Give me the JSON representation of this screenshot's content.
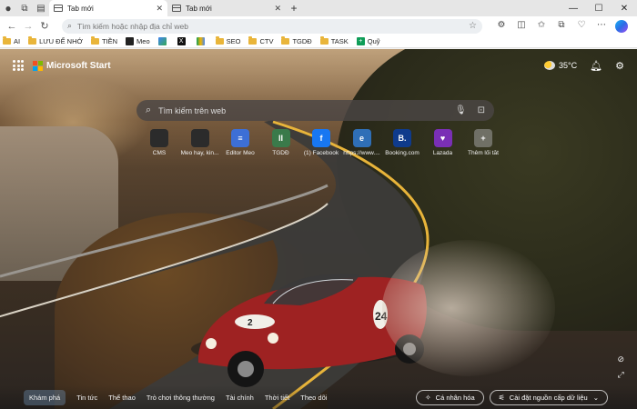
{
  "browser": {
    "tabs": [
      {
        "title": "Tab mới",
        "active": true
      },
      {
        "title": "Tab mới",
        "active": false
      }
    ],
    "address_placeholder": "Tìm kiếm hoặc nhập địa chỉ web",
    "bookmarks": [
      {
        "label": "AI",
        "kind": "folder"
      },
      {
        "label": "LƯU ĐỂ NHỚ",
        "kind": "folder"
      },
      {
        "label": "TIỀN",
        "kind": "folder"
      },
      {
        "label": "Meo",
        "kind": "page"
      },
      {
        "label": "",
        "kind": "drive"
      },
      {
        "label": "",
        "kind": "x"
      },
      {
        "label": "",
        "kind": "gdrive"
      },
      {
        "label": "SEO",
        "kind": "folder"
      },
      {
        "label": "CTV",
        "kind": "folder"
      },
      {
        "label": "TGDĐ",
        "kind": "folder"
      },
      {
        "label": "TASK",
        "kind": "folder"
      },
      {
        "label": "Quỹ",
        "kind": "sheet"
      }
    ]
  },
  "start": {
    "brand": "Microsoft Start",
    "weather": "35°C",
    "search_placeholder": "Tìm kiếm trên web",
    "quicklinks": [
      {
        "label": "CMS",
        "icon": "",
        "color": "#2b2b2b"
      },
      {
        "label": "Meo hay, kin...",
        "icon": "",
        "color": "#2b2b2b"
      },
      {
        "label": "Editor Meo",
        "icon": "≡",
        "color": "#3d6fd6"
      },
      {
        "label": "TGDĐ",
        "icon": "II",
        "color": "#3a7a4a"
      },
      {
        "label": "(1) Facebook",
        "icon": "f",
        "color": "#1877f2"
      },
      {
        "label": "https://www....",
        "icon": "e",
        "color": "#2f6fb7"
      },
      {
        "label": "Booking.com",
        "icon": "B.",
        "color": "#0f3b8c"
      },
      {
        "label": "Lazada",
        "icon": "♥",
        "color": "#7a2fb5"
      },
      {
        "label": "Thêm lối tắt",
        "icon": "+",
        "color": "rgba(160,160,160,0.55)"
      }
    ],
    "feed_tabs": [
      "Khám phá",
      "Tin tức",
      "Thể thao",
      "Trò chơi thông thường",
      "Tài chính",
      "Thời tiết",
      "Theo dõi"
    ],
    "personalize": "Cá nhân hóa",
    "feed_settings": "Cài đặt nguồn cấp dữ liệu"
  }
}
